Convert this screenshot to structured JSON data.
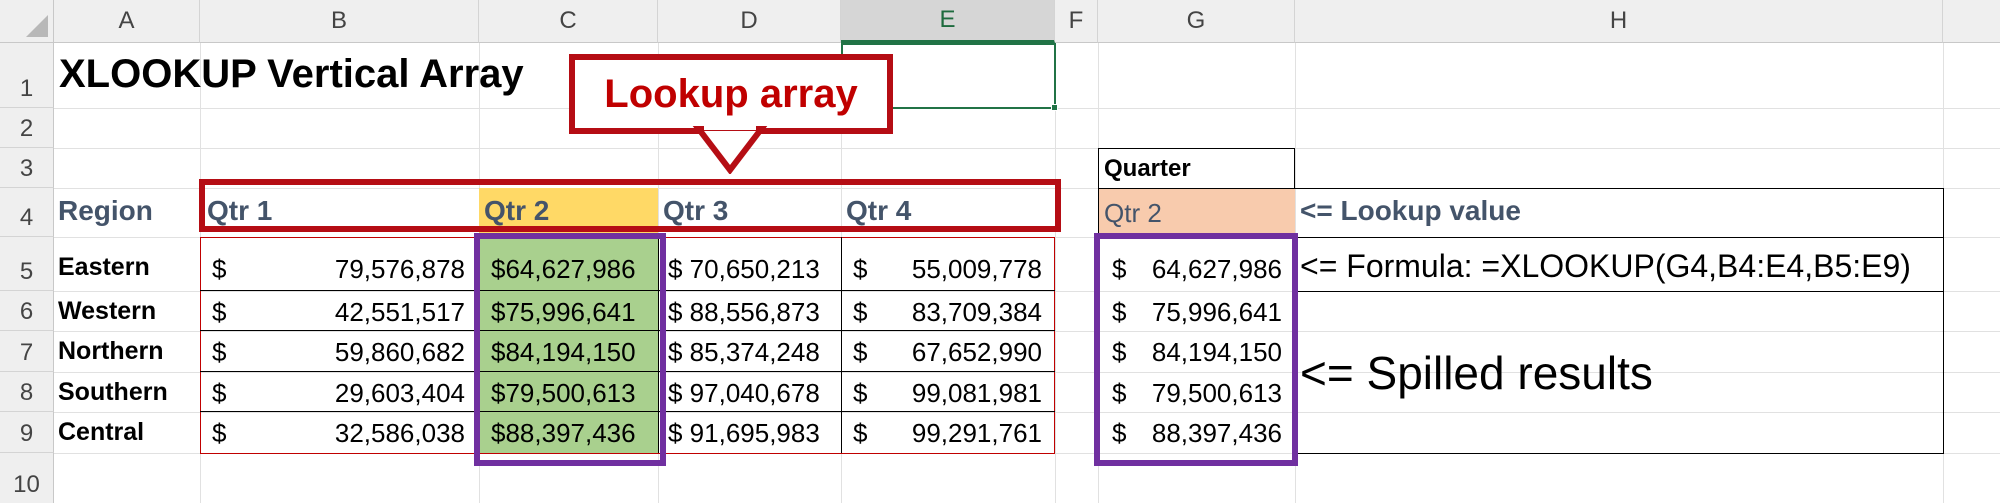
{
  "columns": [
    "A",
    "B",
    "C",
    "D",
    "E",
    "F",
    "G",
    "H"
  ],
  "rows": [
    "1",
    "2",
    "3",
    "4",
    "5",
    "6",
    "7",
    "8",
    "9",
    "10"
  ],
  "title": "XLOOKUP Vertical Array",
  "callout_label": "Lookup array",
  "header_region": "Region",
  "quarters": [
    "Qtr 1",
    "Qtr 2",
    "Qtr 3",
    "Qtr 4"
  ],
  "regions": [
    "Eastern",
    "Western",
    "Northern",
    "Southern",
    "Central"
  ],
  "values": [
    [
      "79,576,878",
      "$64,627,986",
      "$ 70,650,213",
      "55,009,778"
    ],
    [
      "42,551,517",
      "$75,996,641",
      "$ 88,556,873",
      "83,709,384"
    ],
    [
      "59,860,682",
      "$84,194,150",
      "$ 85,374,248",
      "67,652,990"
    ],
    [
      "29,603,404",
      "$79,500,613",
      "$ 97,040,678",
      "99,081,981"
    ],
    [
      "32,586,038",
      "$88,397,436",
      "$ 91,695,983",
      "99,291,761"
    ]
  ],
  "currency_symbol": "$",
  "quarter_label": "Quarter",
  "lookup_value": "Qtr 2",
  "lookup_value_note": "<= Lookup value",
  "formula_note": "<= Formula: =XLOOKUP(G4,B4:E4,B5:E9)",
  "results": [
    "64,627,986",
    "75,996,641",
    "84,194,150",
    "79,500,613",
    "88,397,436"
  ],
  "spilled_note": "<= Spilled results",
  "colors": {
    "red_outline": "#b50d14",
    "purple_outline": "#7030a0",
    "green_fill": "#a9d08e",
    "yellow_fill": "#ffd966",
    "orange_fill": "#f8cbad",
    "header_text": "#44546a"
  }
}
